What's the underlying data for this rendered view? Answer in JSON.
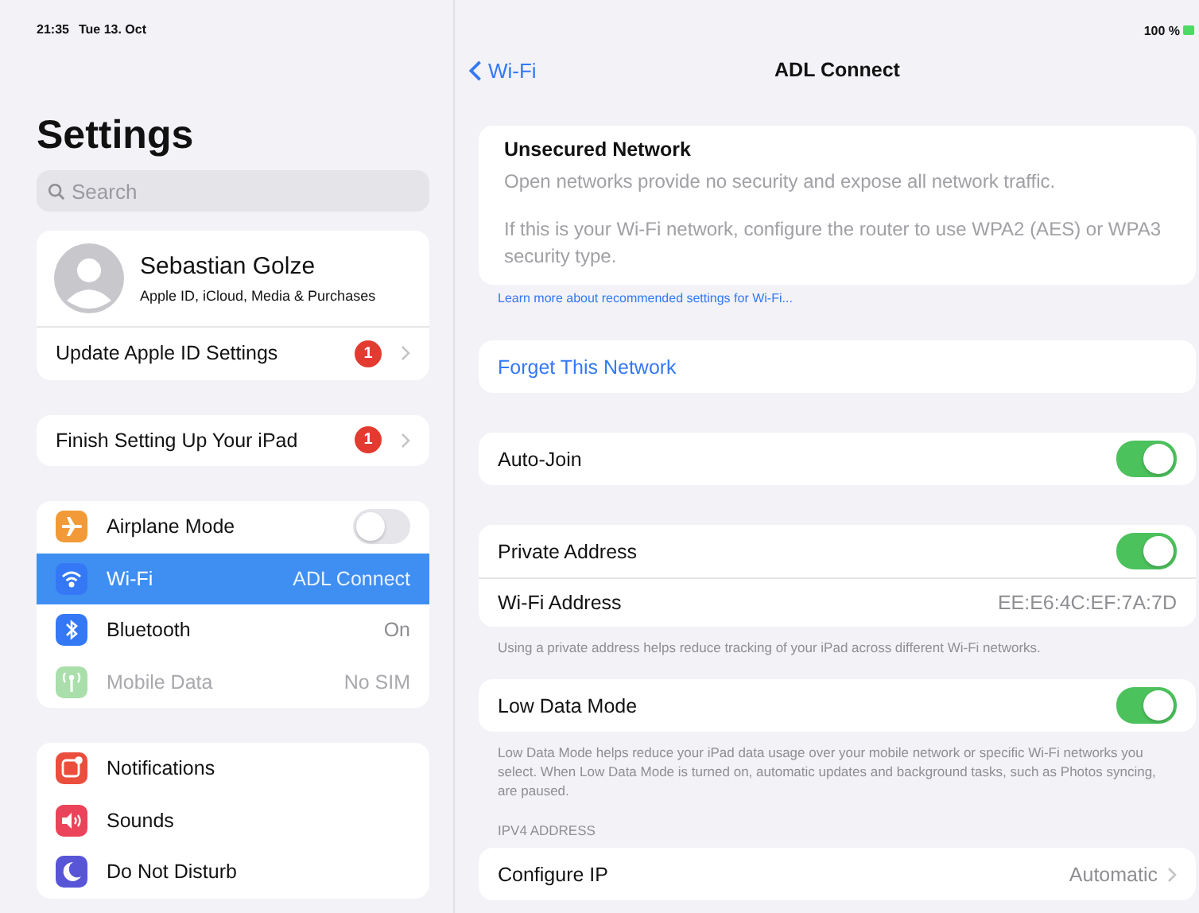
{
  "status_bar": {
    "time": "21:35",
    "date": "Tue 13. Oct",
    "battery": "100 %"
  },
  "sidebar": {
    "title": "Settings",
    "search": {
      "placeholder": "Search"
    },
    "profile": {
      "name": "Sebastian Golze",
      "subtitle": "Apple ID, iCloud, Media & Purchases"
    },
    "groups": [
      [
        {
          "kind": "badge",
          "label": "Update Apple ID Settings",
          "badge": "1"
        }
      ],
      [
        {
          "kind": "badge",
          "label": "Finish Setting Up Your iPad",
          "badge": "1"
        }
      ],
      [
        {
          "kind": "toggle",
          "label": "Airplane Mode",
          "on": false,
          "selected": false,
          "disabled": false
        },
        {
          "kind": "value",
          "label": "Wi-Fi",
          "value": "ADL Connect",
          "selected": true,
          "disabled": false
        },
        {
          "kind": "value",
          "label": "Bluetooth",
          "value": "On",
          "selected": false,
          "disabled": false
        },
        {
          "kind": "value",
          "label": "Mobile Data",
          "value": "No SIM",
          "selected": false,
          "disabled": true
        }
      ],
      [
        {
          "kind": "plain",
          "label": "Notifications",
          "selected": false,
          "disabled": false
        },
        {
          "kind": "plain",
          "label": "Sounds",
          "selected": false,
          "disabled": false
        },
        {
          "kind": "plain",
          "label": "Do Not Disturb",
          "selected": false,
          "disabled": false
        }
      ]
    ]
  },
  "detail": {
    "back": "Wi-Fi",
    "title": "ADL Connect",
    "blocks": [
      {
        "kind": "card",
        "rows": [
          {
            "kind": "notice",
            "title": "Unsecured Network",
            "paragraphs": [
              "Open networks provide no security and expose all network traffic.",
              "If this is your Wi-Fi network, configure the router to use WPA2 (AES) or WPA3 security type."
            ]
          }
        ]
      },
      {
        "kind": "link",
        "text": "Learn more about recommended settings for Wi-Fi..."
      },
      {
        "kind": "card",
        "rows": [
          {
            "kind": "action",
            "label": "Forget This Network"
          }
        ]
      },
      {
        "kind": "card",
        "rows": [
          {
            "kind": "toggle",
            "label": "Auto-Join",
            "on": true
          }
        ]
      },
      {
        "kind": "card",
        "rows": [
          {
            "kind": "toggle",
            "label": "Private Address",
            "on": true
          },
          {
            "kind": "value",
            "label": "Wi-Fi Address",
            "value": "EE:E6:4C:EF:7A:7D"
          }
        ]
      },
      {
        "kind": "footer",
        "text": "Using a private address helps reduce tracking of your iPad across different Wi-Fi networks."
      },
      {
        "kind": "card",
        "rows": [
          {
            "kind": "toggle",
            "label": "Low Data Mode",
            "on": true
          }
        ]
      },
      {
        "kind": "footer",
        "text": "Low Data Mode helps reduce your iPad data usage over your mobile network or specific Wi-Fi networks you select. When Low Data Mode is turned on, automatic updates and background tasks, such as Photos syncing, are paused."
      },
      {
        "kind": "header",
        "text": "IPV4 ADDRESS"
      },
      {
        "kind": "card",
        "rows": [
          {
            "kind": "chevron",
            "label": "Configure IP",
            "value": "Automatic"
          }
        ]
      }
    ]
  }
}
